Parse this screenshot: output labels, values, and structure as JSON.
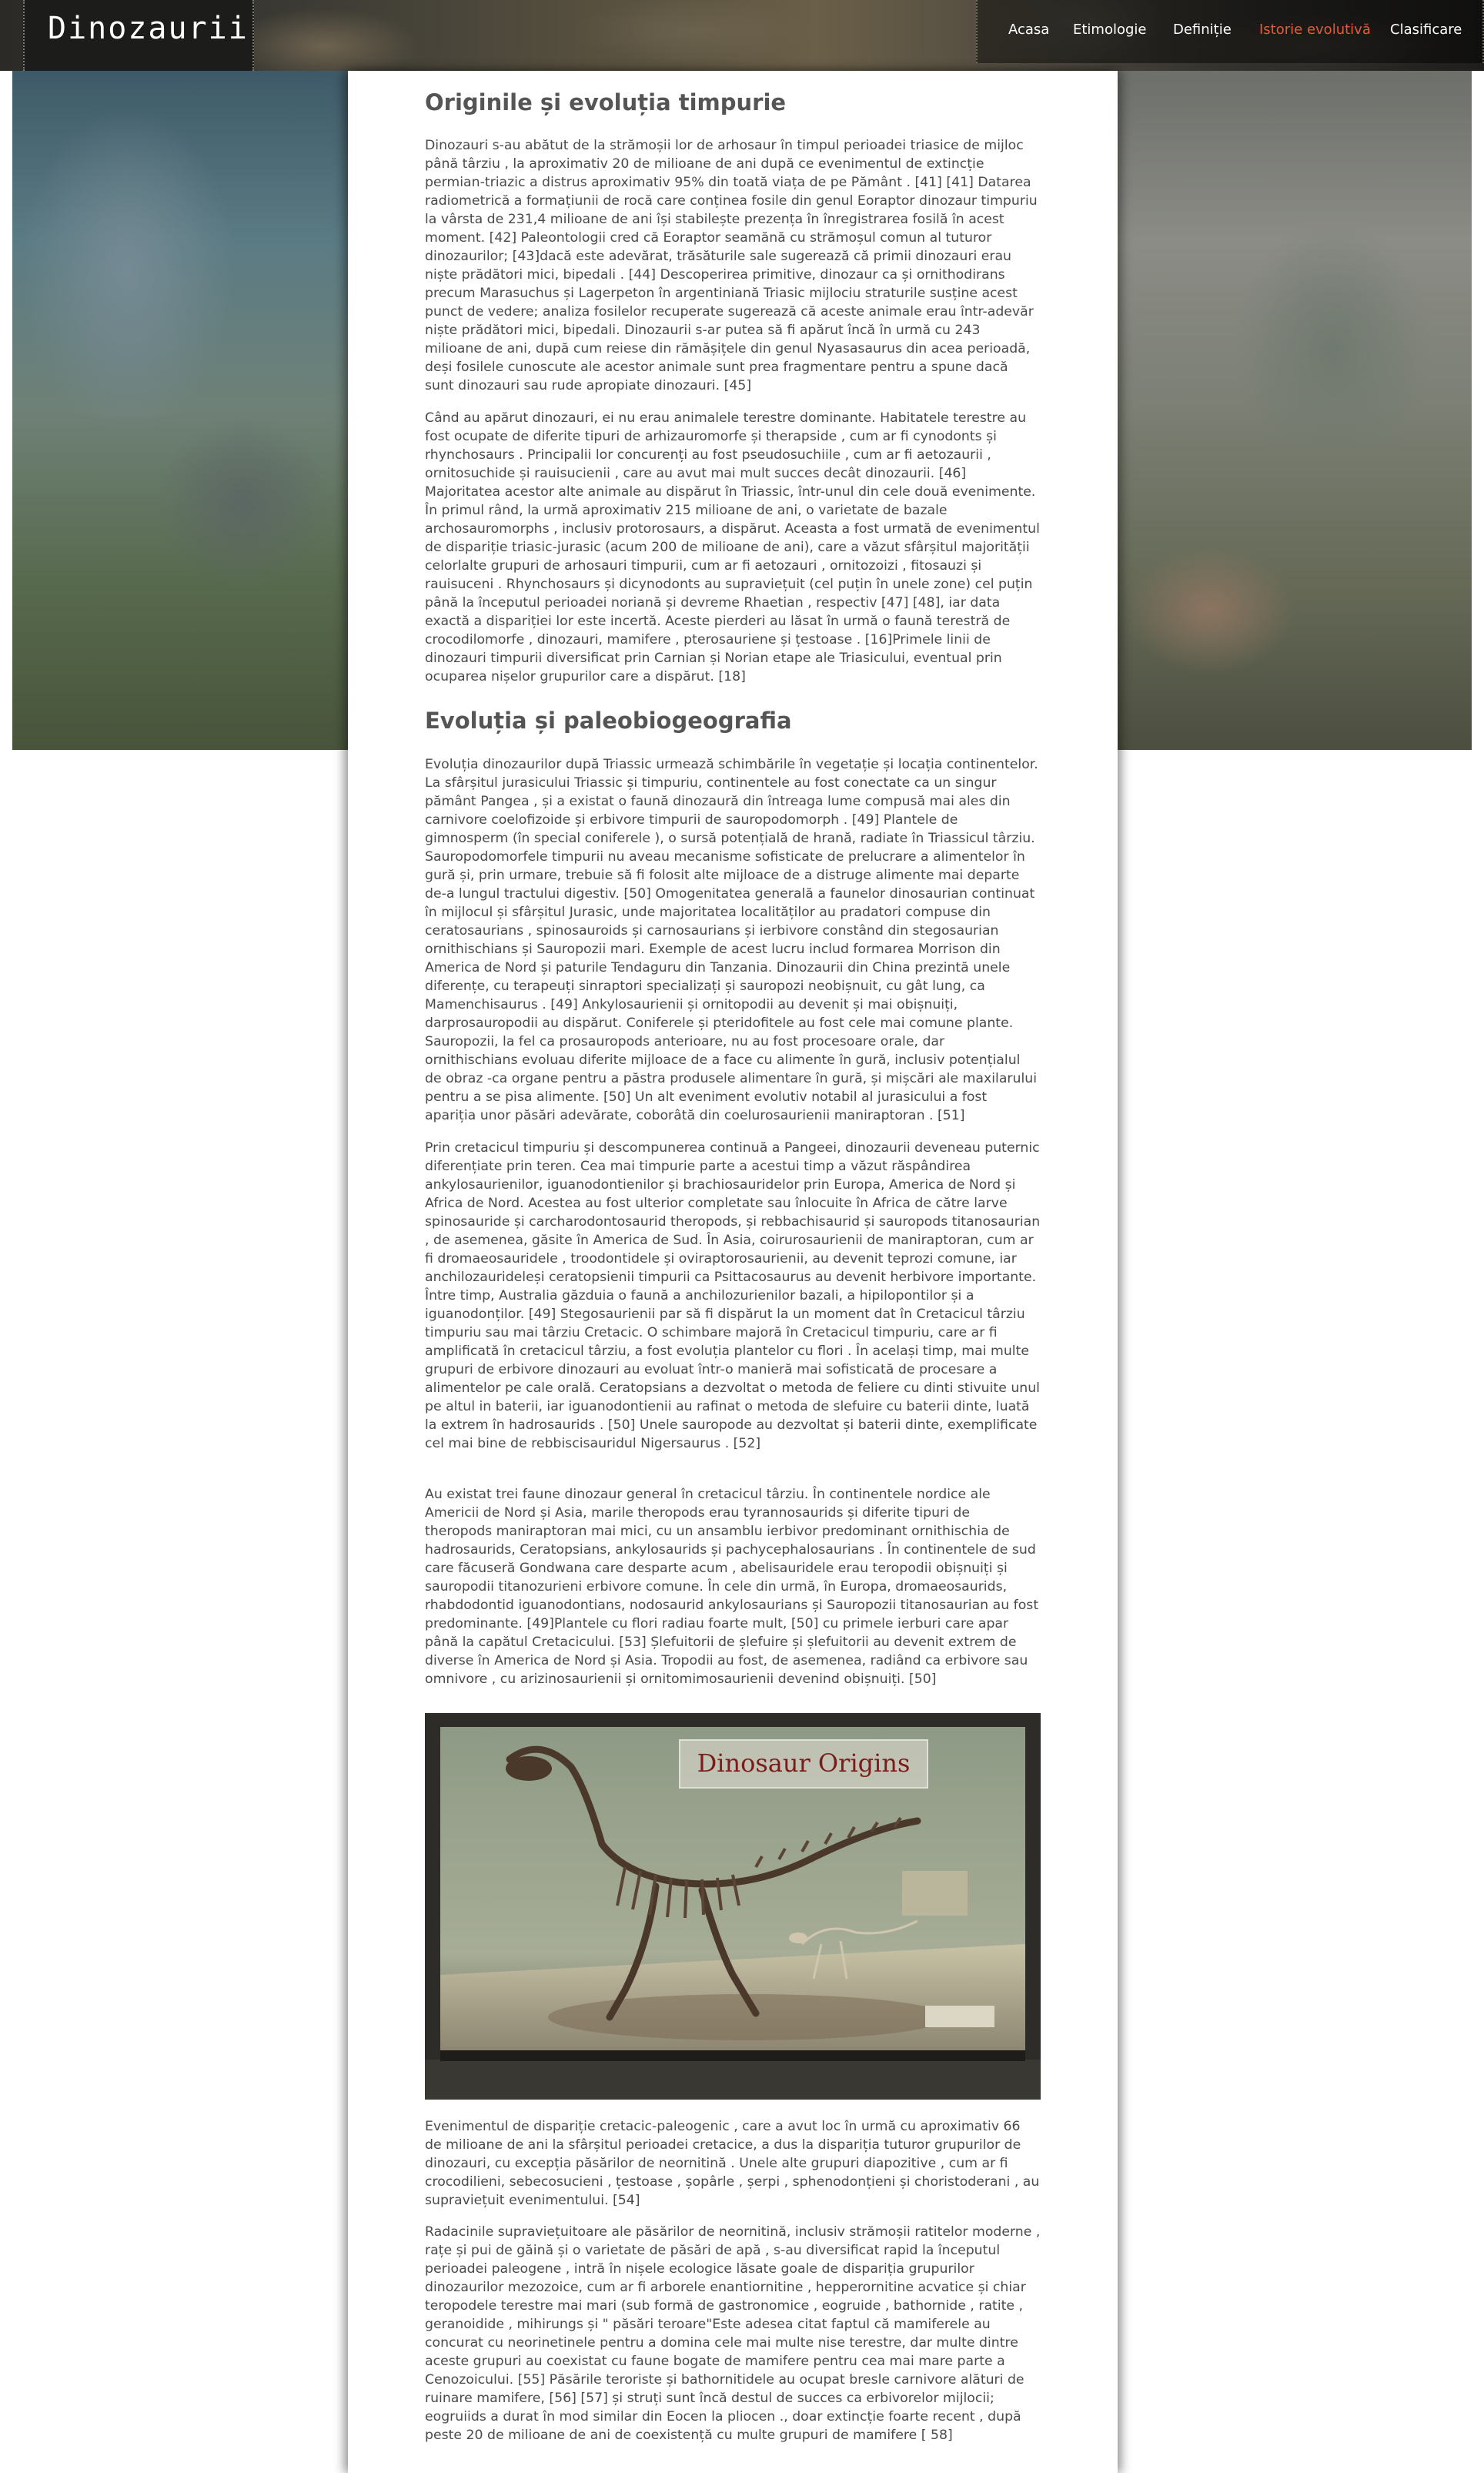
{
  "site": {
    "title": "Dinozaurii"
  },
  "nav": {
    "items": [
      {
        "label": "Acasa"
      },
      {
        "label": "Etimologie"
      },
      {
        "label": "Definiție"
      },
      {
        "label": "Istorie evolutivă",
        "active": true
      },
      {
        "label": "Clasificare"
      }
    ],
    "active_color": "#e65a3a"
  },
  "sections": {
    "s1": {
      "heading": "Originile și evoluția timpurie",
      "p1": "Dinozauri s-au abătut de la strămoșii lor de arhosaur în timpul perioadei triasice de mijloc până târziu , la aproximativ 20 de milioane de ani după ce evenimentul de extincție permian-triazic a distrus aproximativ 95% din toată viața de pe Pământ . [41] [41] Datarea radiometrică a formațiunii de rocă care conținea fosile din genul Eoraptor dinozaur timpuriu la vârsta de 231,4 milioane de ani își stabilește prezența în înregistrarea fosilă în acest moment. [42] Paleontologii cred că Eoraptor seamănă cu strămoșul comun al tuturor dinozaurilor; [43]dacă este adevărat, trăsăturile sale sugerează că primii dinozauri erau niște prădători mici, bipedali . [44] Descoperirea primitive, dinozaur ca și ornithodirans precum Marasuchus și Lagerpeton în argentiniană Triasic mijlociu straturile susține acest punct de vedere; analiza fosilelor recuperate sugerează că aceste animale erau într-adevăr niște prădători mici, bipedali. Dinozaurii s-ar putea să fi apărut încă în urmă cu 243 milioane de ani, după cum reiese din rămășițele din genul Nyasasaurus din acea perioadă, deși fosilele cunoscute ale acestor animale sunt prea fragmentare pentru a spune dacă sunt dinozauri sau rude apropiate dinozauri. [45]",
      "p2": "Când au apărut dinozauri, ei nu erau animalele terestre dominante. Habitatele terestre au fost ocupate de diferite tipuri de arhizauromorfe și therapside , cum ar fi cynodonts și rhynchosaurs . Principalii lor concurenți au fost pseudosuchiile , cum ar fi aetozaurii , ornitosuchide și rauisucienii , care au avut mai mult succes decât dinozaurii. [46] Majoritatea acestor alte animale au dispărut în Triassic, într-unul din cele două evenimente. În primul rând, la urmă aproximativ 215 milioane de ani, o varietate de bazale archosauromorphs , inclusiv protorosaurs, a dispărut. Aceasta a fost urmată de evenimentul de dispariție triasic-jurasic (acum 200 de milioane de ani), care a văzut sfârșitul majorității celorlalte grupuri de arhosauri timpurii, cum ar fi aetozauri , ornitozoizi , fitosauzi și rauisuceni . Rhynchosaurs și dicynodonts au supraviețuit (cel puțin în unele zone) cel puțin până la începutul perioadei noriană și devreme Rhaetian , respectiv [47] [48], iar data exactă a dispariției lor este incertă. Aceste pierderi au lăsat în urmă o faună terestră de crocodilomorfe , dinozauri, mamifere , pterosauriene și țestoase . [16]Primele linii de dinozauri timpurii diversificat prin Carnian și Norian etape ale Triasicului, eventual prin ocuparea nișelor grupurilor care a dispărut. [18]"
    },
    "s2": {
      "heading": "Evoluția și paleobiogeografia",
      "p3": "Evoluția dinozaurilor după Triassic urmează schimbările în vegetație și locația continentelor. La sfârșitul jurasicului Triassic și timpuriu, continentele au fost conectate ca un singur pământ Pangea , și a existat o faună dinozaură din întreaga lume compusă mai ales din carnivore coelofizoide și erbivore timpurii de sauropodomorph . [49] Plantele de gimnosperm (în special coniferele ), o sursă potențială de hrană, radiate în Triassicul târziu. Sauropodomorfele timpurii nu aveau mecanisme sofisticate de prelucrare a alimentelor în gură și, prin urmare, trebuie să fi folosit alte mijloace de a distruge alimente mai departe de-a lungul tractului digestiv. [50] Omogenitatea generală a faunelor dinosaurian continuat în mijlocul și sfârșitul Jurasic, unde majoritatea localităților au pradatori compuse din ceratosaurians , spinosauroids și carnosaurians și ierbivore constând din stegosaurian ornithischians și Sauropozii mari. Exemple de acest lucru includ formarea Morrison din America de Nord și paturile Tendaguru din Tanzania. Dinozaurii din China prezintă unele diferențe, cu terapeuți sinraptori specializați și sauropozi neobișnuit, cu gât lung, ca Mamenchisaurus . [49] Ankylosaurienii și ornitopodii au devenit și mai obișnuiți, darprosauropodii au dispărut. Coniferele și pteridofitele au fost cele mai comune plante. Sauropozii, la fel ca prosauropods anterioare, nu au fost procesoare orale, dar ornithischians evoluau diferite mijloace de a face cu alimente în gură, inclusiv potențialul de obraz -ca organe pentru a păstra produsele alimentare în gură, și mișcări ale maxilarului pentru a se pisa alimente. [50] Un alt eveniment evolutiv notabil al jurasicului a fost apariția unor păsări adevărate, coborâtă din coelurosaurienii maniraptoran . [51]",
      "p4": "Prin cretacicul timpuriu și descompunerea continuă a Pangeei, dinozaurii deveneau puternic diferențiate prin teren. Cea mai timpurie parte a acestui timp a văzut răspândirea ankylosaurienilor, iguanodontienilor și brachiosauridelor prin Europa, America de Nord și Africa de Nord. Acestea au fost ulterior completate sau înlocuite în Africa de către larve spinosauride și carcharodontosaurid theropods, și rebbachisaurid și sauropods titanosaurian , de asemenea, găsite în America de Sud. În Asia, coirurosaurienii de maniraptoran, cum ar fi dromaeosauridele , troodontidele și oviraptorosaurienii, au devenit teprozi comune, iar anchilozaurideleși ceratopsienii timpurii ca Psittacosaurus au devenit herbivore importante. Între timp, Australia găzduia o faună a anchilozurienilor bazali, a hipilopontilor și a iguanodonților. [49] Stegosaurienii par să fi dispărut la un moment dat în Cretacicul târziu timpuriu sau mai târziu Cretacic. O schimbare majoră în Cretacicul timpuriu, care ar fi amplificată în cretacicul târziu, a fost evoluția plantelor cu flori . În același timp, mai multe grupuri de erbivore dinozauri au evoluat într-o manieră mai sofisticată de procesare a alimentelor pe cale orală. Ceratopsians a dezvoltat o metoda de feliere cu dinti stivuite unul pe altul in baterii, iar iguanodontienii au rafinat o metoda de slefuire cu baterii dinte, luată la extrem în hadrosaurids . [50] Unele sauropode au dezvoltat și baterii dinte, exemplificate cel mai bine de rebbiscisauridul Nigersaurus . [52]",
      "p5": "Au existat trei faune dinozaur general în cretacicul târziu. În continentele nordice ale Americii de Nord și Asia, marile theropods erau tyrannosaurids și diferite tipuri de theropods maniraptoran mai mici, cu un ansamblu ierbivor predominant ornithischia de hadrosaurids, Ceratopsians, ankylosaurids și pachycephalosaurians . În continentele de sud care făcuseră Gondwana care desparte acum , abelisauridele erau teropodii obișnuiți și sauropodii titanozurieni erbivore comune. În cele din urmă, în Europa, dromaeosaurids, rhabdodontid iguanodontians, nodosaurid ankylosaurians și Sauropozii titanosaurian au fost predominante. [49]Plantele cu flori radiau foarte mult, [50] cu primele ierburi care apar până la capătul Cretacicului. [53] Șlefuitorii de șlefuire și șlefuitorii au devenit extrem de diverse în America de Nord și Asia. Tropodii au fost, de asemenea, radiând ca erbivore sau omnivore , cu arizinosaurienii și ornitomimosaurienii devenind obișnuiți. [50]",
      "image_sign": "Dinosaur Origins",
      "p6": "Evenimentul de dispariție cretacic-paleogenic , care a avut loc în urmă cu aproximativ 66 de milioane de ani la sfârșitul perioadei cretacice, a dus la dispariția tuturor grupurilor de dinozauri, cu excepția păsărilor de neornitină . Unele alte grupuri diapozitive , cum ar fi crocodilieni, sebecosucieni , țestoase , șopârle , șerpi , sphenodonțieni și choristoderani , au supraviețuit evenimentului. [54]",
      "p7": "Radacinile supraviețuitoare ale păsărilor de neornitină, inclusiv strămoșii ratitelor moderne , rațe și pui de găină și o varietate de păsări de apă , s-au diversificat rapid la începutul perioadei paleogene , intră în nișele ecologice lăsate goale de dispariția grupurilor dinozaurilor mezozoice, cum ar fi arborele enantiornitine , hepperornitine acvatice și chiar teropodele terestre mai mari (sub formă de gastronomice , eogruide , bathornide , ratite , geranoidide , mihirungs și \" păsări teroare\"Este adesea citat faptul că mamiferele au concurat cu neorinetinele pentru a domina cele mai multe nise terestre, dar multe dintre aceste grupuri au coexistat cu faune bogate de mamifere pentru cea mai mare parte a Cenozoicului. [55] Păsările teroriste și bathornitidele au ocupat bresle carnivore alături de ruinare mamifere, [56] [57] și struți sunt încă destul de succes ca erbivorelor mijlocii; eogruiids a durat în mod similar din Eocen la pliocen ., doar extincție foarte recent , după peste 20 de milioane de ani de coexistență cu multe grupuri de mamifere [ 58]"
    }
  }
}
